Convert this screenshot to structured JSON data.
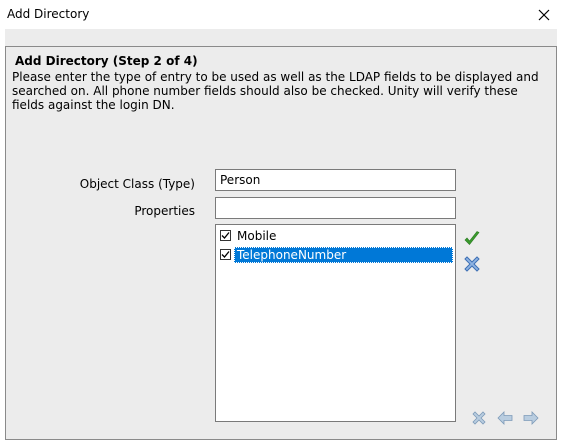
{
  "window": {
    "title": "Add Directory"
  },
  "step": {
    "heading": "Add Directory (Step 2 of 4)",
    "description": "Please enter the type of entry to be used as well as the LDAP fields to be displayed and searched on.  All phone number fields should also be checked. Unity will verify these fields against the login DN."
  },
  "form": {
    "object_class_label": "Object Class (Type)",
    "object_class_value": "Person",
    "properties_label": "Properties",
    "properties_value": ""
  },
  "properties_list": [
    {
      "label": "Mobile",
      "checked": true,
      "selected": false
    },
    {
      "label": "TelephoneNumber",
      "checked": true,
      "selected": true
    }
  ],
  "icons": {
    "add": "green-check-icon",
    "remove": "blue-x-icon",
    "cancel": "cancel-icon",
    "back": "back-arrow-icon",
    "next": "next-arrow-icon"
  },
  "colors": {
    "selection": "#0078d7",
    "panel": "#ececec",
    "check_green": "#3a9a2e",
    "x_blue": "#4a7fc4",
    "nav_gray": "#9bb3c9"
  }
}
